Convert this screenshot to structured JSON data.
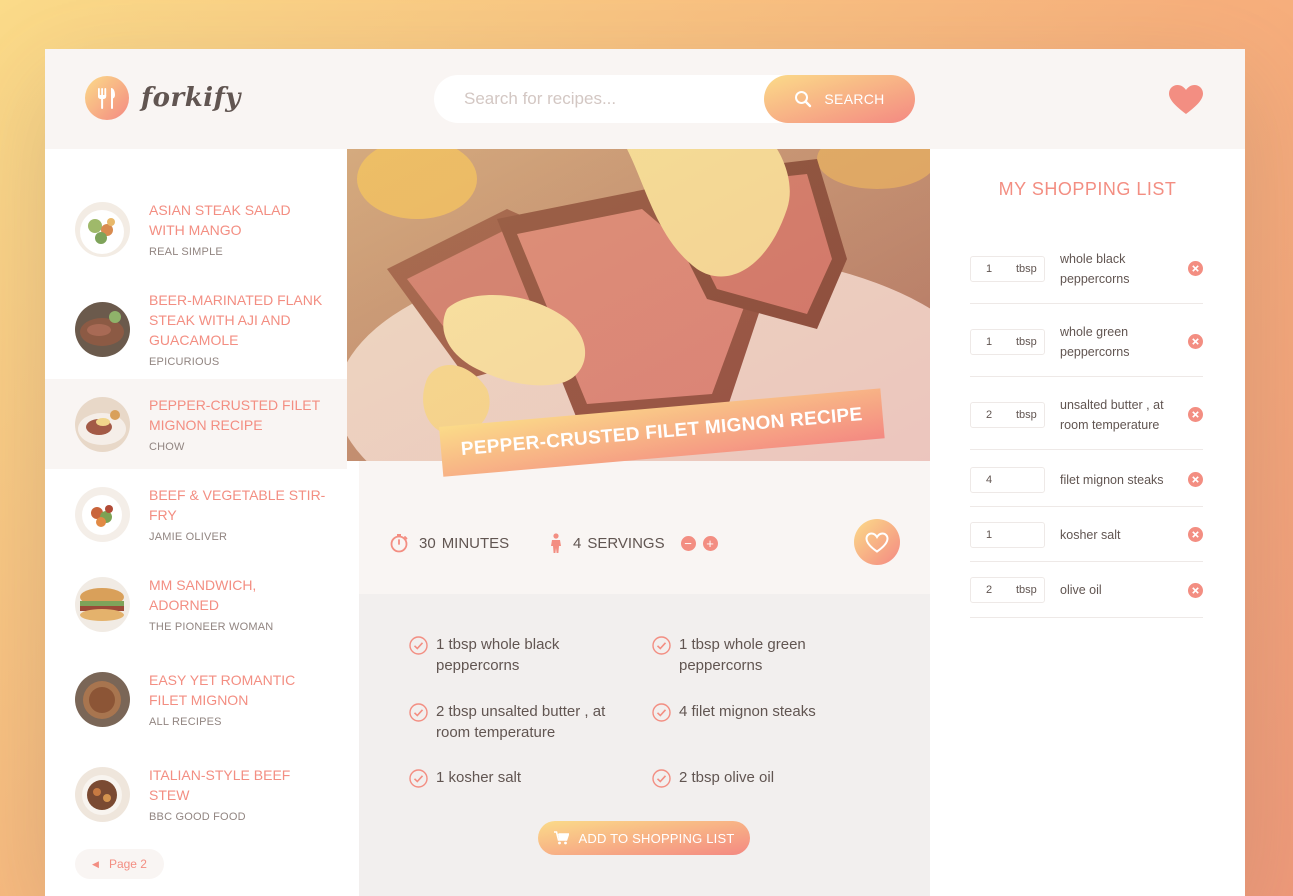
{
  "app": {
    "name": "forkify"
  },
  "search": {
    "placeholder": "Search for recipes...",
    "button_label": "SEARCH"
  },
  "results": [
    {
      "title": "ASIAN STEAK SALAD WITH MANGO",
      "publisher": "REAL SIMPLE"
    },
    {
      "title": "BEER-MARINATED FLANK STEAK WITH AJI AND GUACAMOLE",
      "publisher": "EPICURIOUS"
    },
    {
      "title": "PEPPER-CRUSTED FILET MIGNON RECIPE",
      "publisher": "CHOW"
    },
    {
      "title": "BEEF & VEGETABLE STIR-FRY",
      "publisher": "JAMIE OLIVER"
    },
    {
      "title": "MM SANDWICH, ADORNED",
      "publisher": "THE PIONEER WOMAN"
    },
    {
      "title": "EASY YET ROMANTIC FILET MIGNON",
      "publisher": "ALL RECIPES"
    },
    {
      "title": "ITALIAN-STYLE BEEF STEW",
      "publisher": "BBC GOOD FOOD"
    }
  ],
  "pagination": {
    "label": "Page 2"
  },
  "recipe": {
    "title": "PEPPER-CRUSTED FILET MIGNON RECIPE",
    "time_value": "30",
    "time_unit": "MINUTES",
    "servings_value": "4",
    "servings_unit": "SERVINGS",
    "minus": "−",
    "plus": "+",
    "ingredients": [
      {
        "text": "1 tbsp whole black peppercorns"
      },
      {
        "text": "1 tbsp whole green peppercorns"
      },
      {
        "text": "2 tbsp unsalted butter , at room temperature"
      },
      {
        "text": "4 filet mignon steaks"
      },
      {
        "text": "1 kosher salt"
      },
      {
        "text": "2 tbsp olive oil"
      }
    ],
    "add_button_label": "ADD TO SHOPPING LIST"
  },
  "shopping": {
    "heading": "MY SHOPPING LIST",
    "items": [
      {
        "count": "1",
        "unit": "tbsp",
        "description": "whole black peppercorns"
      },
      {
        "count": "1",
        "unit": "tbsp",
        "description": "whole green peppercorns"
      },
      {
        "count": "2",
        "unit": "tbsp",
        "description": "unsalted butter , at room temperature"
      },
      {
        "count": "4",
        "unit": "",
        "description": "filet mignon steaks"
      },
      {
        "count": "1",
        "unit": "",
        "description": "kosher salt"
      },
      {
        "count": "2",
        "unit": "tbsp",
        "description": "olive oil"
      }
    ]
  },
  "colors": {
    "accent": "#f38e82",
    "gradient_start": "#fbdb89",
    "gradient_end": "#f48982",
    "text": "#615551"
  }
}
